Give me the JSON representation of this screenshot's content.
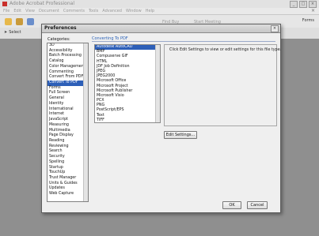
{
  "app": {
    "title": "Adobe Acrobat Professional",
    "menu": [
      "File",
      "Edit",
      "View",
      "Document",
      "Comments",
      "Tools",
      "Advanced",
      "Window",
      "Help"
    ],
    "forms_label": "Forms",
    "select_label": "Select",
    "faint_toolbar_text": "Find  Buy",
    "faint_toolbar_text2": "Start Meeting"
  },
  "dialog": {
    "title": "Preferences",
    "categories_label": "Categories:",
    "categories": [
      "3D",
      "Accessibility",
      "Batch Processing",
      "Catalog",
      "Color Management",
      "Commenting",
      "Convert From PDF",
      "Convert To PDF",
      "Forms",
      "Full Screen",
      "General",
      "Identity",
      "International",
      "Internet",
      "JavaScript",
      "Measuring",
      "Multimedia",
      "Page Display",
      "Reading",
      "Reviewing",
      "Search",
      "Security",
      "Spelling",
      "Startup",
      "TouchUp",
      "Trust Manager",
      "Units & Guides",
      "Updates",
      "Web Capture"
    ],
    "selected_category": "Convert To PDF",
    "section_title": "Converting To PDF",
    "formats": [
      "Autodesk AutoCAD",
      "BMP",
      "Compuserve GIF",
      "HTML",
      "JDF Job Definition",
      "JPEG",
      "JPEG2000",
      "Microsoft Office",
      "Microsoft Project",
      "Microsoft Publisher",
      "Microsoft Visio",
      "PCX",
      "PNG",
      "PostScript/EPS",
      "Text",
      "TIFF"
    ],
    "info_text": "Click Edit Settings to view or edit settings for this file type.",
    "edit_settings_label": "Edit Settings...",
    "ok_label": "OK",
    "cancel_label": "Cancel"
  },
  "colors": {
    "selection": "#2d5fb8",
    "section_title": "#2c63b8"
  }
}
